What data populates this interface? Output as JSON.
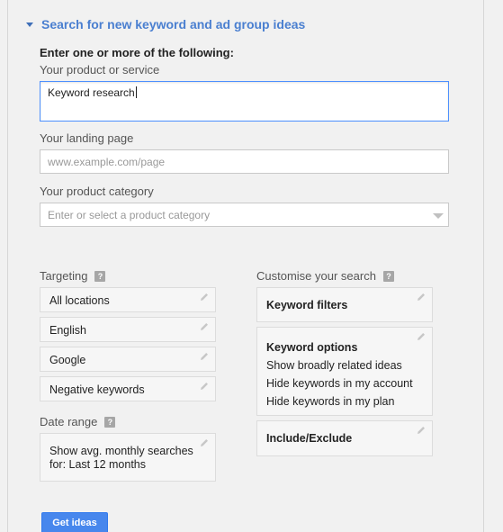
{
  "section": {
    "title": "Search for new keyword and ad group ideas"
  },
  "form": {
    "lead": "Enter one or more of the following:",
    "product_label": "Your product or service",
    "product_value": "Keyword research",
    "landing_label": "Your landing page",
    "landing_placeholder": "www.example.com/page",
    "category_label": "Your product category",
    "category_placeholder": "Enter or select a product category"
  },
  "targeting": {
    "label": "Targeting",
    "help": "?",
    "items": [
      {
        "label": "All locations"
      },
      {
        "label": "English"
      },
      {
        "label": "Google"
      },
      {
        "label": "Negative keywords"
      }
    ]
  },
  "date_range": {
    "label": "Date range",
    "help": "?",
    "line1": "Show avg. monthly searches",
    "line2": "for: Last 12 months"
  },
  "customise": {
    "label": "Customise your search",
    "help": "?",
    "keyword_filters": "Keyword filters",
    "keyword_options": {
      "title": "Keyword options",
      "lines": [
        "Show broadly related ideas",
        "Hide keywords in my account",
        "Hide keywords in my plan"
      ]
    },
    "include_exclude": "Include/Exclude"
  },
  "actions": {
    "get_ideas": "Get ideas"
  },
  "colors": {
    "link": "#4a7fd0",
    "primary_button": "#4787ed",
    "focus_border": "#4d90fe"
  }
}
